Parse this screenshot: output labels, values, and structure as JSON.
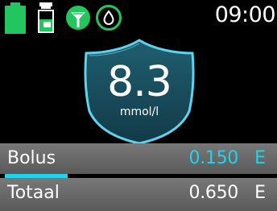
{
  "status_bar": {
    "time": "09:00",
    "icons": [
      "battery-icon",
      "reservoir-icon",
      "sensor-icon",
      "calibration-drop-icon"
    ]
  },
  "bg_reading": {
    "value": "8.3",
    "unit": "mmol/l"
  },
  "bolus_row": {
    "label": "Bolus",
    "value": "0.150",
    "unit": "E",
    "progress": 0.23
  },
  "total_row": {
    "label": "Totaal",
    "value": "0.650",
    "unit": "E"
  },
  "colors": {
    "accent_cyan": "#22d3ee",
    "status_green": "#22c55e"
  }
}
